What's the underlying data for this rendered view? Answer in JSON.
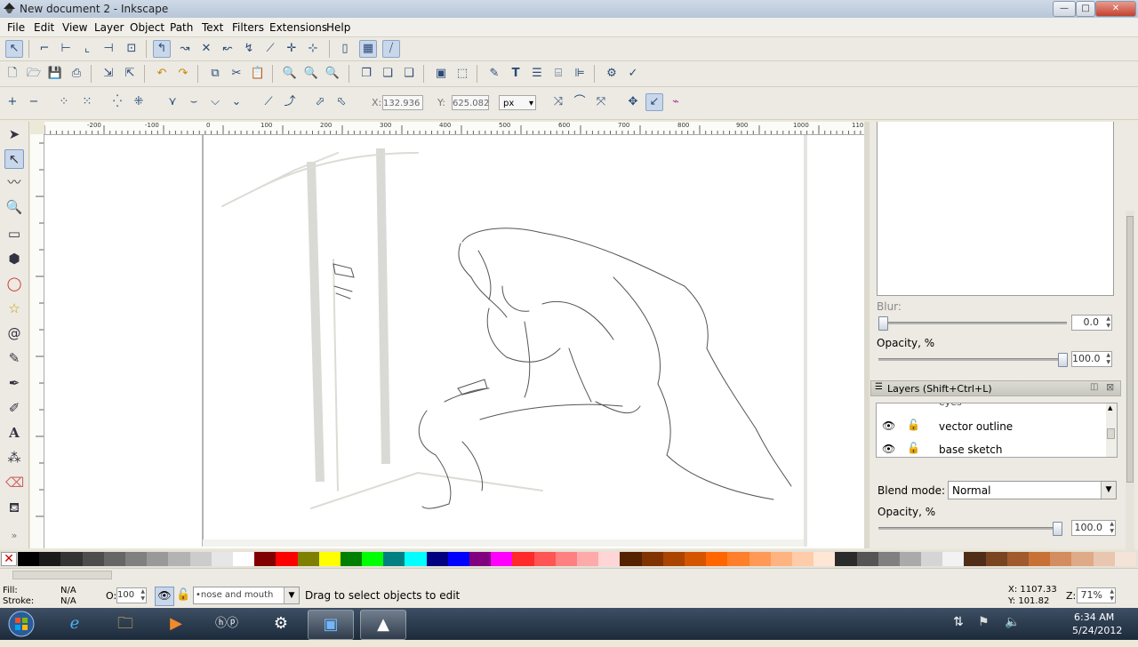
{
  "window": {
    "title": "New document 2 - Inkscape"
  },
  "menu": [
    "File",
    "Edit",
    "View",
    "Layer",
    "Object",
    "Path",
    "Text",
    "Filters",
    "Extensions",
    "Help"
  ],
  "controls": {
    "x_label": "X:",
    "x_value": "132.936",
    "y_label": "Y:",
    "y_value": "625.082",
    "unit": "px"
  },
  "rulers": {
    "h_ticks": [
      "-200",
      "-100",
      "0",
      "100",
      "200",
      "300",
      "400",
      "500",
      "600",
      "700",
      "800",
      "900",
      "1000",
      "110"
    ]
  },
  "filters_panel": {
    "blur_label": "Blur:",
    "blur_value": "0.0",
    "blur_fraction": 0.0,
    "opacity_label": "Opacity, %",
    "opacity_value": "100.0",
    "opacity_fraction": 1.0
  },
  "layers_panel": {
    "title": "Layers (Shift+Ctrl+L)",
    "partial_item": "eyes",
    "items": [
      {
        "name": "vector outline"
      },
      {
        "name": "base sketch"
      }
    ],
    "blend_label": "Blend mode:",
    "blend_value": "Normal",
    "opacity_label": "Opacity, %",
    "opacity_value": "100.0",
    "opacity_fraction": 1.0,
    "buttons": [
      "add-layer",
      "raise-to-top",
      "raise",
      "lower",
      "lower-to-bottom",
      "remove"
    ]
  },
  "palette": [
    "#000000",
    "#1a1a1a",
    "#333333",
    "#4d4d4d",
    "#666666",
    "#808080",
    "#999999",
    "#b3b3b3",
    "#cccccc",
    "#e6e6e6",
    "#ffffff",
    "#800000",
    "#ff0000",
    "#808000",
    "#ffff00",
    "#008000",
    "#00ff00",
    "#008080",
    "#00ffff",
    "#000080",
    "#0000ff",
    "#800080",
    "#ff00ff",
    "#ff2a2a",
    "#ff5555",
    "#ff8080",
    "#ffaaaa",
    "#ffd5d5",
    "#552200",
    "#803300",
    "#aa4400",
    "#d45500",
    "#ff6600",
    "#ff7f2a",
    "#ff9955",
    "#ffb380",
    "#ffccaa",
    "#ffe6d5",
    "#2b2b2b",
    "#555555",
    "#808080",
    "#aaaaaa",
    "#d5d5d5",
    "#f2f2f2",
    "#502d16",
    "#784421",
    "#a05a2c",
    "#c87137",
    "#d38d5f",
    "#deaa87",
    "#e9c6af",
    "#f4e3d7"
  ],
  "status": {
    "fill_label": "Fill:",
    "fill_value": "N/A",
    "stroke_label": "Stroke:",
    "stroke_value": "N/A",
    "opacity_label": "O:",
    "opacity_value": "100",
    "layer_value": "•nose and mouth",
    "message": "Drag to select objects to edit",
    "x_coord": "X: 1107.33",
    "y_coord": "Y:   101.82",
    "zoom_label": "Z:",
    "zoom_value": "71%"
  },
  "taskbar": {
    "time": "6:34 AM",
    "date": "5/24/2012",
    "apps": [
      "windows-start",
      "internet-explorer",
      "file-explorer",
      "media-player",
      "hp",
      "steam",
      "remote-desktop",
      "inkscape"
    ]
  }
}
